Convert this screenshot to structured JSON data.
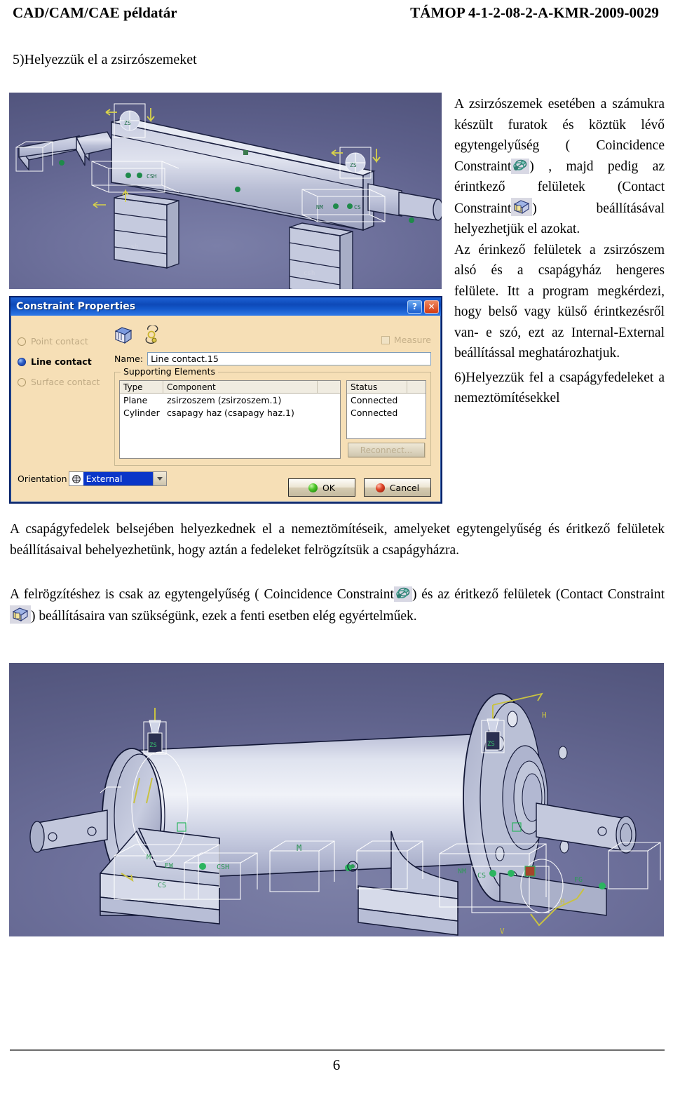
{
  "header": {
    "left": "CAD/CAM/CAE példatár",
    "right": "TÁMOP 4-1-2-08-2-A-KMR-2009-0029"
  },
  "section": {
    "title": "5)Helyezzük el a zsirzószemeket"
  },
  "right_column": {
    "para1_part1": "A zsirzószemek esetében a számukra készült furatok és köztük lévő egytengelyűség",
    "para1_part2": "( Coincidence Constraint",
    "para1_part3": ", majd pedig az érintkező felületek (Contact Constraint",
    "para1_part4": ")",
    "para1_part5": ")",
    "para1_part6": "beállításával helyezhetjük el azokat.",
    "para2": "Az érinkező felületek a zsirzószem alsó és a csapágyház hengeres felülete. Itt a program megkérdezi, hogy belső vagy külső érintkezésről van- e szó, ezt az Internal-External beállítással meghatározhatjuk.",
    "para3": "6)Helyezzük fel a csapágyfedeleket a nemeztömítésekkel"
  },
  "body": {
    "para_fedelek": "A csapágyfedelek belsejében helyezkednek el a nemeztömítéseik, amelyeket egytengelyűség és éritkező felületek beállításaival behelyezhetünk, hogy aztán a fedeleket felrögzítsük a csapágyházra.",
    "para_felrogzites_1": "A felrögzítéshez is csak az egytengelyűség (  Coincidence Constraint",
    "para_felrogzites_2": ") és az éritkező felületek (Contact Constraint",
    "para_felrogzites_3": ") beállításaira van szükségünk, ezek a fenti esetben elég egyértelműek."
  },
  "dialog": {
    "title": "Constraint Properties",
    "help_button": "?",
    "close_button": "✕",
    "contact_types": [
      {
        "label": "Point contact",
        "selected": false,
        "enabled": false
      },
      {
        "label": "Line contact",
        "selected": true,
        "enabled": true
      },
      {
        "label": "Surface contact",
        "selected": false,
        "enabled": false
      }
    ],
    "measure": {
      "label": "Measure",
      "checked": false,
      "enabled": false
    },
    "name": {
      "label": "Name:",
      "value": "Line contact.15"
    },
    "supporting_elements": {
      "caption": "Supporting Elements",
      "columns": [
        "Type",
        "Component",
        "",
        "Status",
        ""
      ],
      "rows": [
        {
          "type": "Plane",
          "component": "zsirzoszem (zsirzoszem.1)",
          "status": "Connected"
        },
        {
          "type": "Cylinder",
          "component": "csapagy haz (csapagy haz.1)",
          "status": "Connected"
        }
      ],
      "reconnect_button": "Reconnect..."
    },
    "orientation": {
      "label": "Orientation",
      "value": "External"
    },
    "ok_button": "OK",
    "cancel_button": "Cancel",
    "colors": {
      "titlebar": "#0d49b8",
      "face": "#f6dfb6",
      "border": "#0a246a",
      "selection": "#0a36c8"
    }
  },
  "icons": {
    "coincidence_constraint": "coincidence-constraint-icon",
    "contact_constraint": "contact-constraint-icon"
  },
  "cad_views": {
    "top": "cad-shaft-with-grease-nipples",
    "bottom": "cad-bearing-housing-with-covers"
  },
  "footer": {
    "page_number": "6"
  }
}
